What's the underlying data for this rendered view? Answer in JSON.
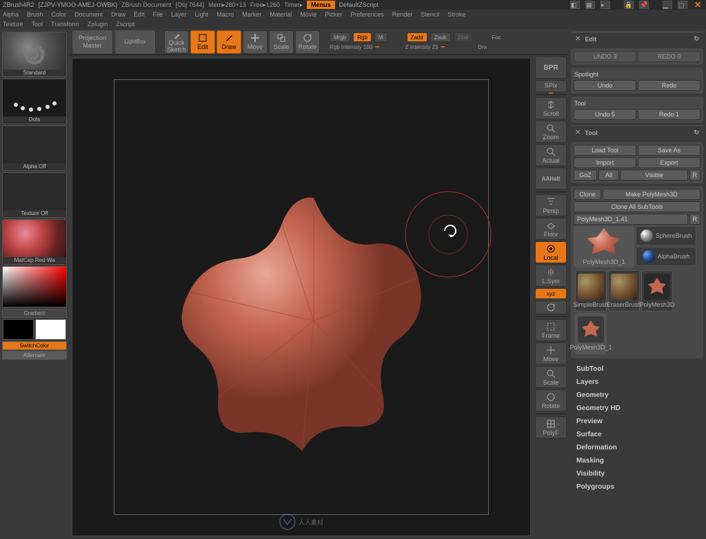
{
  "titlebar": {
    "app": "ZBrush4R2",
    "doc": "[ZJPV-YMOO-AMEJ-OWBK]",
    "title": "ZBrush Document",
    "obj": "[Obj 7644]",
    "mem": "Mem▸280+13",
    "free": "Free▸1260",
    "timer": "Timer▸",
    "menus": "Menus",
    "dzs": "DefaultZScript"
  },
  "menus": [
    "Alpha",
    "Brush",
    "Color",
    "Document",
    "Draw",
    "Edit",
    "File",
    "Layer",
    "Light",
    "Macro",
    "Marker",
    "Material",
    "Movie",
    "Picker",
    "Preferences",
    "Render",
    "Stencil",
    "Stroke",
    "Texture",
    "Tool",
    "Transform",
    "Zplugin",
    "Zscript"
  ],
  "left": {
    "pm_top": "Projection",
    "pm_bot": "Master",
    "lightbox": "LightBox",
    "qs_top": "Quick",
    "qs_bot": "Sketch",
    "standard": "Standard",
    "dots": "Dots",
    "alpha": "Alpha Off",
    "texture": "Texture Off",
    "material": "MatCap Red Wa",
    "gradient": "Gradient",
    "switch": "SwitchColor",
    "alternate": "Alternate"
  },
  "toolbar": {
    "edit": "Edit",
    "draw": "Draw",
    "move": "Move",
    "scale": "Scale",
    "rotate": "Rotate",
    "mrgb": "Mrgb",
    "rgb": "Rgb",
    "m": "M",
    "zadd": "Zadd",
    "zsub": "Zsub",
    "zcut": "Zcut",
    "foc": "Foc",
    "dra": "Dra",
    "rgbi": "Rgb Intensity 100",
    "zi": "Z Intensity 25"
  },
  "rail": [
    "BPR",
    "SPix",
    "Scroll",
    "Zoom",
    "Actual",
    "AAHalf",
    "Persp",
    "Floor",
    "Local",
    "L.Sym",
    "xyz",
    "Frame",
    "Move",
    "Scale",
    "Rotate",
    "PolyF"
  ],
  "edit": {
    "title": "Edit",
    "undo3": "UNDO 3",
    "redo0": "REDO 0",
    "spotlight": "Spotlight",
    "undo": "Undo",
    "redo": "Redo",
    "tool": "Tool",
    "undo5": "Undo 5",
    "redo1": "Redo 1"
  },
  "tool": {
    "title": "Tool",
    "load": "Load Tool",
    "save": "Save As",
    "import": "Import",
    "export": "Export",
    "goz": "GoZ",
    "all": "All",
    "visible": "Visible",
    "r": "R",
    "clone": "Clone",
    "makepm": "Make PolyMesh3D",
    "cloneall": "Clone All SubTools",
    "current": "PolyMesh3D_1.41",
    "items": [
      "PolyMesh3D_1",
      "SphereBrush",
      "AlphaBrush",
      "SimpleBrush",
      "EraserBrush",
      "PolyMesh3D",
      "PolyMesh3D_1"
    ],
    "sections": [
      "SubTool",
      "Layers",
      "Geometry",
      "Geometry HD",
      "Preview",
      "Surface",
      "Deformation",
      "Masking",
      "Visibility",
      "Polygroups"
    ]
  },
  "watermark": "人人素材"
}
